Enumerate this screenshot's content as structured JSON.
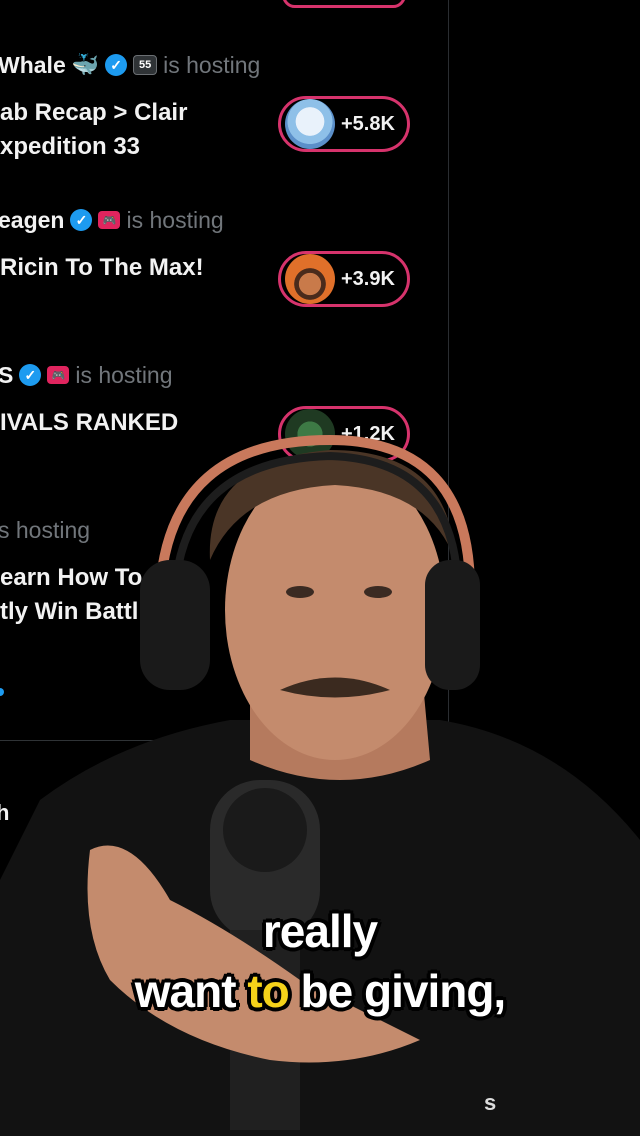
{
  "feed": {
    "items": [
      {
        "host_name": "Whale",
        "host_emoji": "🐳",
        "host_suffix": "is hosting",
        "badge": "55",
        "title_line1": "ab Recap > Clair",
        "title_line2": "xpedition 33",
        "listeners": "+5.8K"
      },
      {
        "host_name": "eagen",
        "host_suffix": "is hosting",
        "badge": "🎮",
        "title_line1": "Ricin To The Max!",
        "title_line2": "",
        "listeners": "+3.9K"
      },
      {
        "host_name": "S",
        "host_suffix": "is hosting",
        "badge": "🎮",
        "title_line1": "IVALS RANKED",
        "title_line2": "",
        "listeners": "+1.2K"
      },
      {
        "host_name": "",
        "host_suffix": "s hosting",
        "title_line1": "earn How To",
        "title_line2": "tly Win Battl"
      }
    ],
    "partial_text": "h"
  },
  "colors": {
    "accent_pink": "#d6336c",
    "verified_blue": "#1d9bf0",
    "caption_highlight": "#f5d21a"
  },
  "caption": {
    "line1": "really",
    "line2_a": "want ",
    "line2_highlight": "to",
    "line2_b": " be giving,"
  },
  "corner_mark": "s"
}
